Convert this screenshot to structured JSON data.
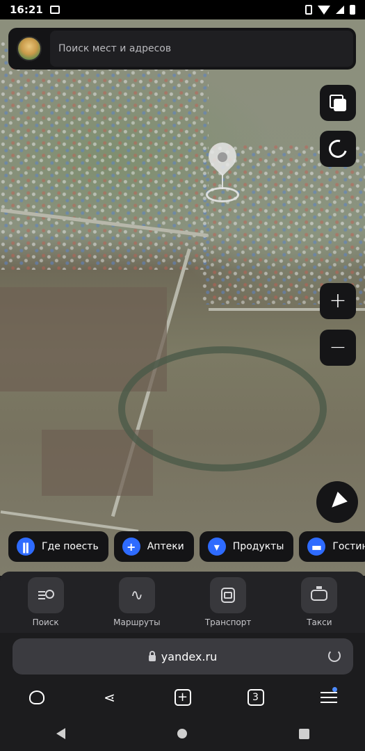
{
  "status_bar": {
    "time": "16:21"
  },
  "search": {
    "placeholder": "Поиск мест и адресов"
  },
  "chips": [
    {
      "label": "Где поесть",
      "icon": "fork-knife-icon"
    },
    {
      "label": "Аптеки",
      "icon": "plus-icon"
    },
    {
      "label": "Продукты",
      "icon": "basket-icon"
    },
    {
      "label": "Гостин",
      "icon": "bed-icon"
    }
  ],
  "maps_nav": [
    {
      "label": "Поиск",
      "icon": "search-list-icon"
    },
    {
      "label": "Маршруты",
      "icon": "route-icon"
    },
    {
      "label": "Транспорт",
      "icon": "bus-icon"
    },
    {
      "label": "Такси",
      "icon": "taxi-icon"
    }
  ],
  "browser": {
    "url": "yandex.ru",
    "tabs_count": "3"
  },
  "colors": {
    "accent": "#2e6bff",
    "panel": "#141416",
    "nav_bg": "#222225"
  }
}
